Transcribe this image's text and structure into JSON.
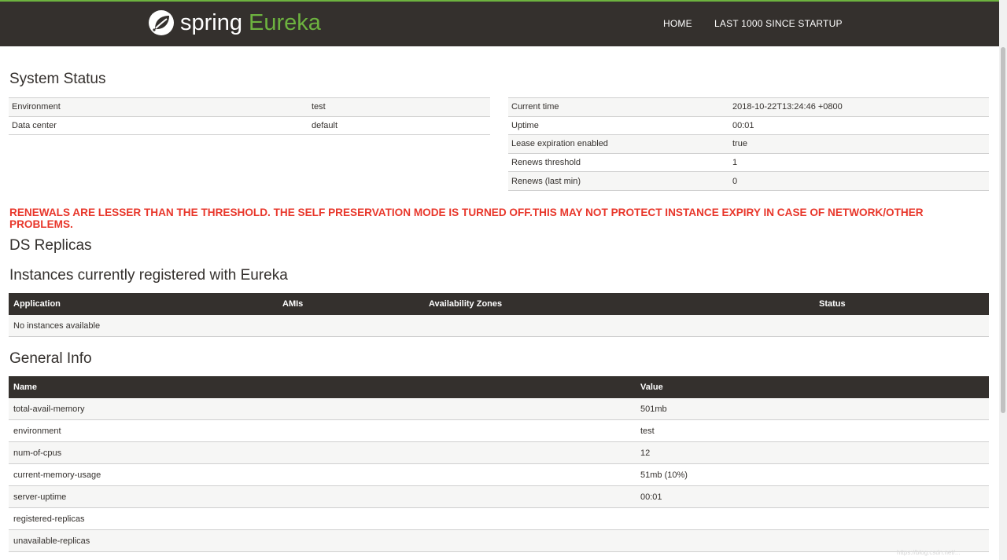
{
  "brand": {
    "spring": "spring",
    "eureka": "Eureka"
  },
  "nav": {
    "home": "HOME",
    "last1000": "LAST 1000 SINCE STARTUP"
  },
  "system_status": {
    "title": "System Status",
    "left": [
      {
        "label": "Environment",
        "value": "test"
      },
      {
        "label": "Data center",
        "value": "default"
      }
    ],
    "right": [
      {
        "label": "Current time",
        "value": "2018-10-22T13:24:46 +0800"
      },
      {
        "label": "Uptime",
        "value": "00:01"
      },
      {
        "label": "Lease expiration enabled",
        "value": "true"
      },
      {
        "label": "Renews threshold",
        "value": "1"
      },
      {
        "label": "Renews (last min)",
        "value": "0"
      }
    ]
  },
  "warning": "RENEWALS ARE LESSER THAN THE THRESHOLD. THE SELF PRESERVATION MODE IS TURNED OFF.THIS MAY NOT PROTECT INSTANCE EXPIRY IN CASE OF NETWORK/OTHER PROBLEMS.",
  "ds_replicas": {
    "title": "DS Replicas"
  },
  "instances": {
    "title": "Instances currently registered with Eureka",
    "columns": [
      "Application",
      "AMIs",
      "Availability Zones",
      "Status"
    ],
    "empty_message": "No instances available"
  },
  "general_info": {
    "title": "General Info",
    "columns": [
      "Name",
      "Value"
    ],
    "rows": [
      {
        "name": "total-avail-memory",
        "value": "501mb"
      },
      {
        "name": "environment",
        "value": "test"
      },
      {
        "name": "num-of-cpus",
        "value": "12"
      },
      {
        "name": "current-memory-usage",
        "value": "51mb (10%)"
      },
      {
        "name": "server-uptime",
        "value": "00:01"
      },
      {
        "name": "registered-replicas",
        "value": ""
      },
      {
        "name": "unavailable-replicas",
        "value": ""
      }
    ]
  },
  "watermark": "https://blog.csdn.net/...",
  "colors": {
    "navbar": "#34302d",
    "accent": "#6db33f",
    "warning": "#e8372b"
  }
}
